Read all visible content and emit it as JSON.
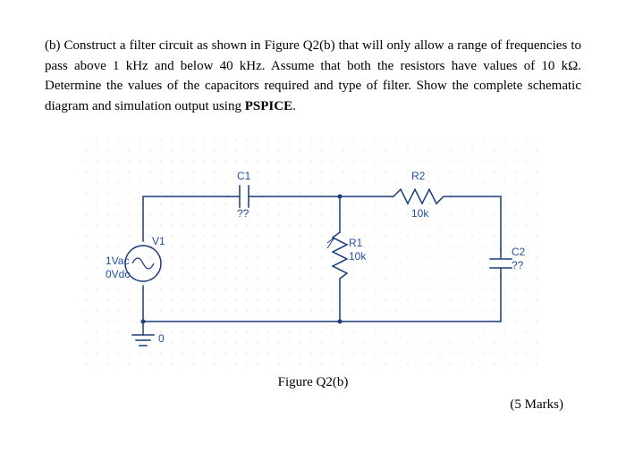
{
  "question": {
    "label": "(b)",
    "text_line1": "Construct a filter circuit as shown in Figure Q2(b) that will only allow a range of frequencies to pass above 1 kHz and below 40 kHz. Assume that both the resistors have values of 10 kΩ. Determine the values of the capacitors required and type of filter. Show the complete schematic diagram and simulation output using ",
    "bold_tool": "PSPICE",
    "text_end": "."
  },
  "circuit": {
    "C1": {
      "name": "C1",
      "value": "??"
    },
    "R1": {
      "name": "R1",
      "value": "10k"
    },
    "R2": {
      "name": "R2",
      "value": "10k"
    },
    "C2": {
      "name": "C2",
      "value": "??"
    },
    "V1": {
      "name": "V1",
      "vac": "1Vac",
      "vdc": "0Vdc"
    },
    "ground": "0"
  },
  "figure_caption": "Figure Q2(b)",
  "marks": "(5 Marks)"
}
